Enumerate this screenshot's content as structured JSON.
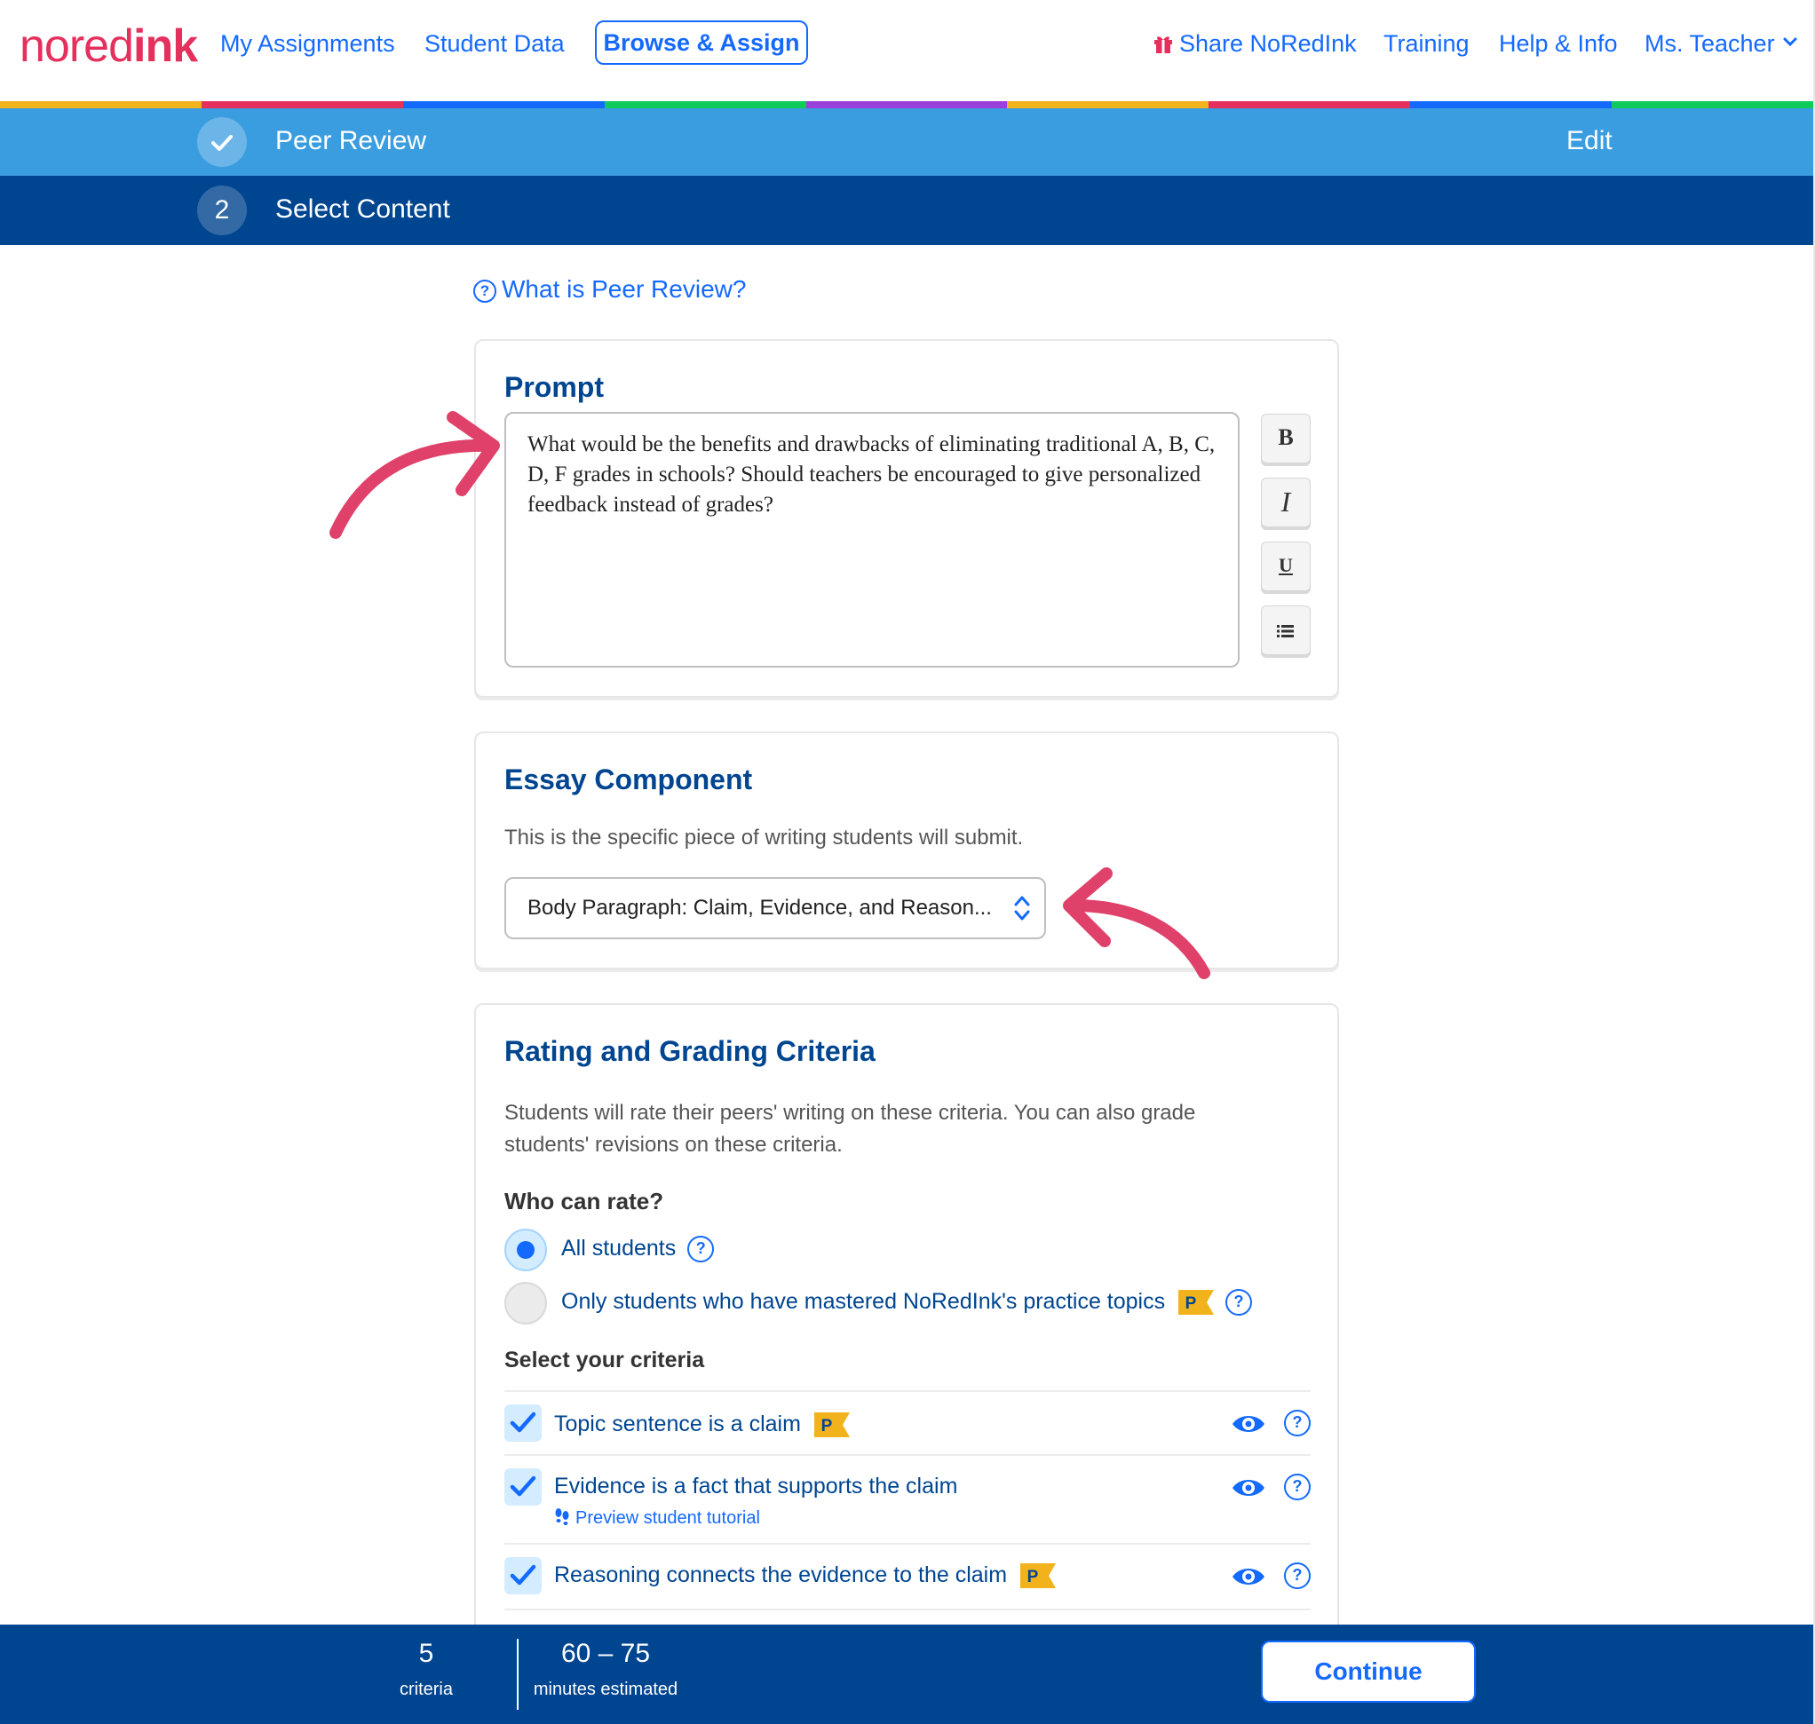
{
  "nav": {
    "logo_a": "nored",
    "logo_b": "ink",
    "links": [
      "My Assignments",
      "Student Data"
    ],
    "active": "Browse & Assign",
    "right_links": [
      "Share NoRedInk",
      "Training",
      "Help & Info"
    ],
    "user": "Ms. Teacher",
    "icons": {
      "share": "gift-icon",
      "user_menu": "chevron-down-icon"
    },
    "rainbow": [
      "#f2b21b",
      "#e5305e",
      "#146aff",
      "#0ecb5c",
      "#9c40db",
      "#f2b21b",
      "#e5305e",
      "#146aff",
      "#0ecb5c"
    ]
  },
  "steps": [
    {
      "marker": "check-icon",
      "label": "Peer Review",
      "action": "Edit"
    },
    {
      "marker": "2",
      "label": "Select Content"
    }
  ],
  "help_link": "What is Peer Review?",
  "prompt_card": {
    "title": "Prompt",
    "text": "What would be the benefits and drawbacks of eliminating traditional A, B, C, D, F grades in schools? Should teachers be encouraged to give personalized feedback instead of grades?",
    "format_buttons": [
      "B",
      "I",
      "U",
      "list-icon"
    ]
  },
  "essay_card": {
    "title": "Essay Component",
    "desc": "This is the specific piece of writing students will submit.",
    "selected": "Body Paragraph: Claim, Evidence, and Reason..."
  },
  "rating_card": {
    "title": "Rating and Grading Criteria",
    "desc": "Students will rate their peers' writing on these criteria. You can also grade students' revisions on these criteria.",
    "who_label": "Who can rate?",
    "options": [
      {
        "label": "All students",
        "selected": true
      },
      {
        "label": "Only students who have mastered NoRedInk's practice topics",
        "selected": false
      }
    ],
    "criteria_label": "Select your criteria",
    "criteria": [
      {
        "label": "Topic sentence is a claim",
        "checked": true,
        "premium": true
      },
      {
        "label": "Evidence is a fact that supports the claim",
        "checked": true,
        "premium": false,
        "sub": "Preview student tutorial"
      },
      {
        "label": "Reasoning connects the evidence to the claim",
        "checked": true,
        "premium": true
      }
    ],
    "badge": "P"
  },
  "footer": {
    "criteria_count": "5",
    "criteria_label": "criteria",
    "minutes": "60 – 75",
    "minutes_label": "minutes estimated",
    "continue": "Continue"
  },
  "colors": {
    "brand": "#e5305e",
    "link": "#146aff",
    "navy": "#004590",
    "step_blue": "#3a9de0",
    "annotation": "#e0416a",
    "badge": "#f2b21b"
  }
}
